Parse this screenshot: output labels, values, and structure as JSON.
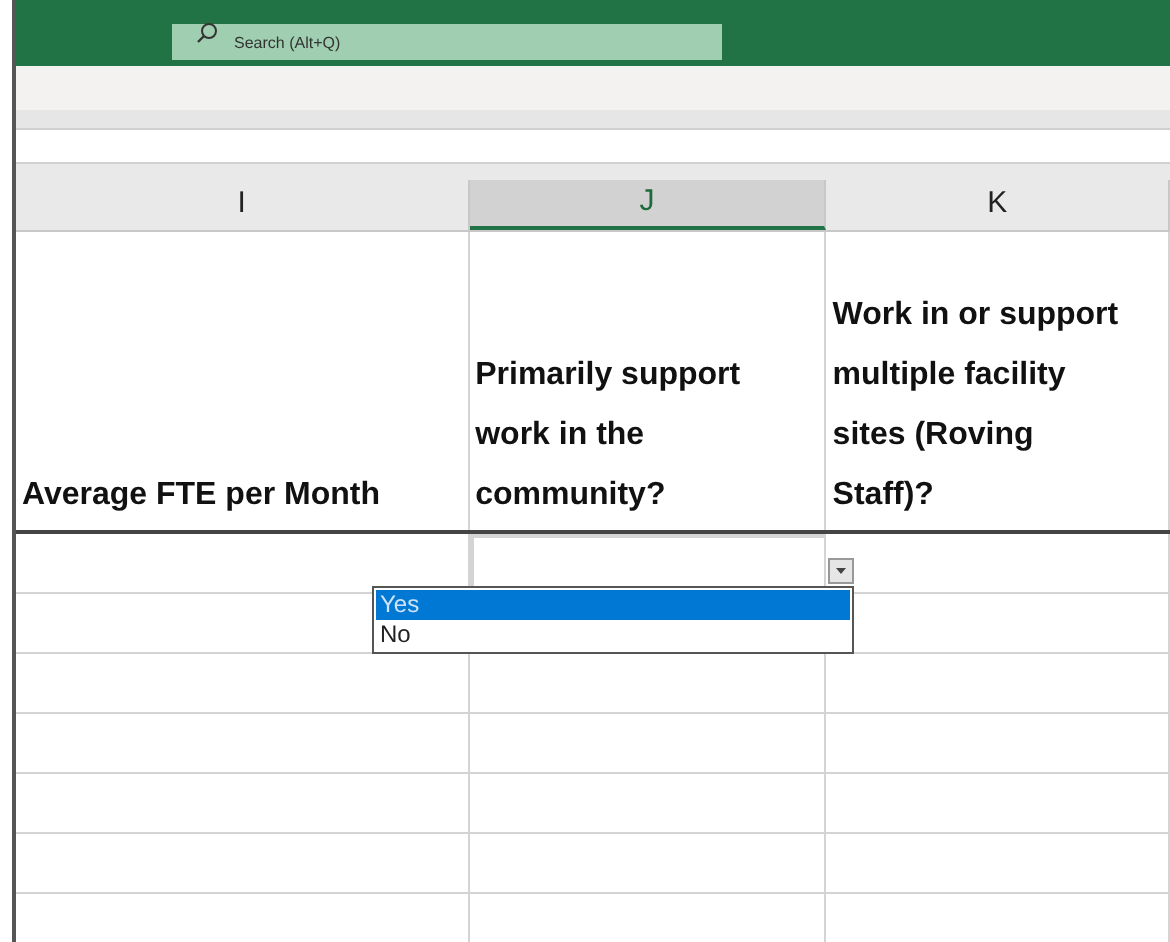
{
  "search": {
    "placeholder": "Search (Alt+Q)"
  },
  "columns": [
    {
      "label": "I",
      "selected": false
    },
    {
      "label": "J",
      "selected": true
    },
    {
      "label": "K",
      "selected": false
    }
  ],
  "header_cells": [
    "Average FTE per Month",
    "Primarily support work in the community?",
    "Work in or support multiple facility sites (Roving Staff)?"
  ],
  "dropdown": {
    "options": [
      {
        "label": "Yes",
        "selected": true
      },
      {
        "label": "No",
        "selected": false
      }
    ]
  }
}
